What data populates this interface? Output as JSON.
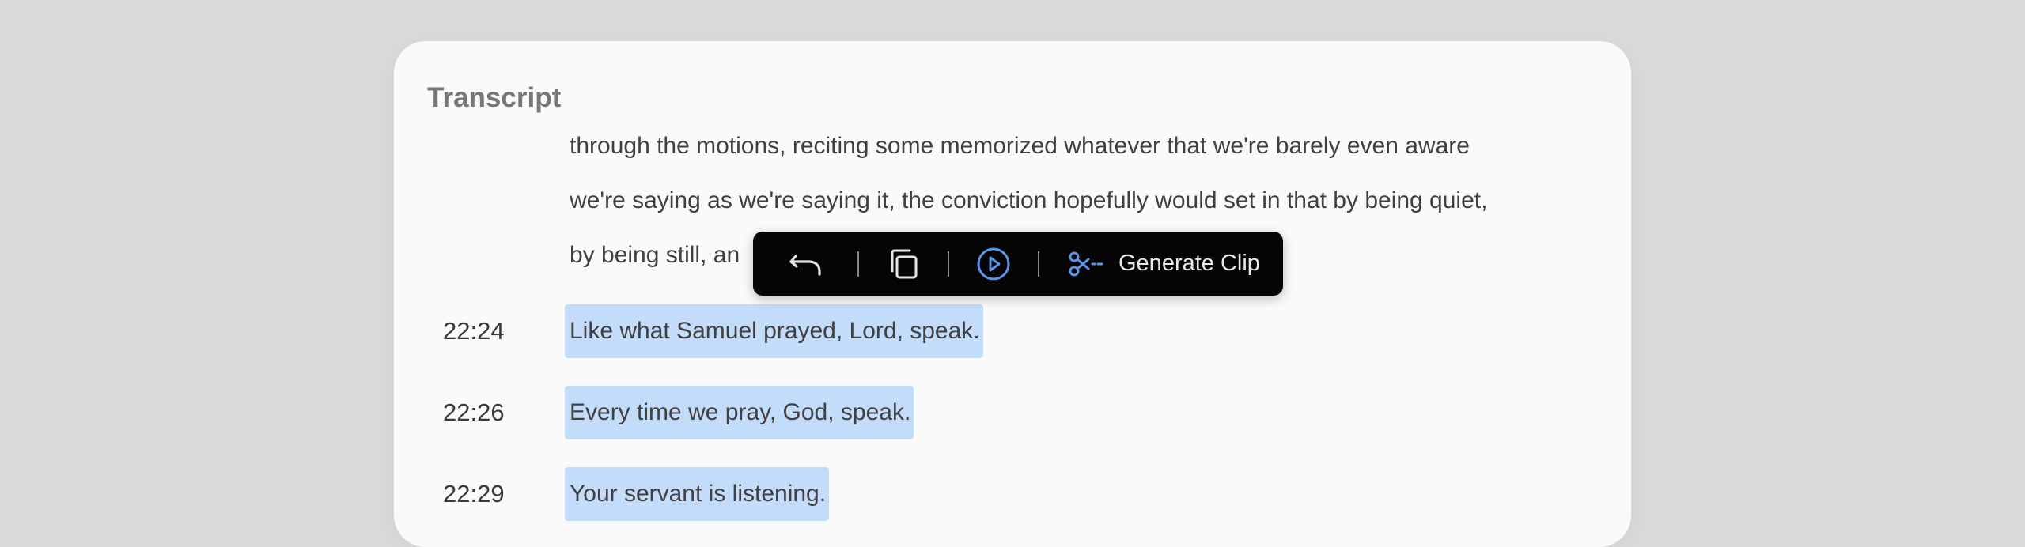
{
  "transcript": {
    "title": "Transcript",
    "paragraph_lines": [
      "through the motions, reciting some memorized whatever that we're barely even aware",
      "we're saying as we're saying it, the conviction hopefully would set in that by being quiet,",
      "by being still, an"
    ],
    "segments": [
      {
        "time": "22:24",
        "text": "Like what Samuel prayed, Lord, speak."
      },
      {
        "time": "22:26",
        "text": "Every time we pray, God, speak."
      },
      {
        "time": "22:29",
        "text": "Your servant is listening."
      }
    ]
  },
  "toolbar": {
    "icons": [
      "undo-icon",
      "copy-icon",
      "play-icon",
      "scissors-icon"
    ],
    "generate_clip_label": "Generate Clip",
    "accent_color": "#5b95e8"
  },
  "colors": {
    "page_background": "#dbdbdb",
    "card_background": "#fafafa",
    "highlight": "#c2dcfa",
    "toolbar_background": "#050505"
  }
}
